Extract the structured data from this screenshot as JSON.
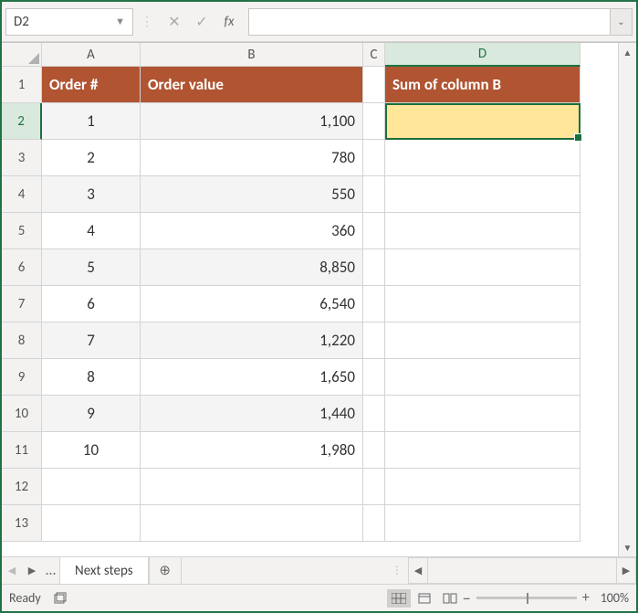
{
  "name_box": "D2",
  "formula_value": "",
  "columns": {
    "A": "A",
    "B": "B",
    "C": "C",
    "D": "D"
  },
  "active_column": "D",
  "active_row": 2,
  "headers": {
    "A": "Order #",
    "B": "Order value",
    "D": "Sum of column B"
  },
  "rows": [
    {
      "r": 2,
      "A": "1",
      "B": "1,100"
    },
    {
      "r": 3,
      "A": "2",
      "B": "780"
    },
    {
      "r": 4,
      "A": "3",
      "B": "550"
    },
    {
      "r": 5,
      "A": "4",
      "B": "360"
    },
    {
      "r": 6,
      "A": "5",
      "B": "8,850"
    },
    {
      "r": 7,
      "A": "6",
      "B": "6,540"
    },
    {
      "r": 8,
      "A": "7",
      "B": "1,220"
    },
    {
      "r": 9,
      "A": "8",
      "B": "1,650"
    },
    {
      "r": 10,
      "A": "9",
      "B": "1,440"
    },
    {
      "r": 11,
      "A": "10",
      "B": "1,980"
    }
  ],
  "empty_rows": [
    "12",
    "13"
  ],
  "sheet": {
    "active_name": "Next steps"
  },
  "status": {
    "mode": "Ready",
    "zoom": "100%"
  },
  "d2_value": ""
}
